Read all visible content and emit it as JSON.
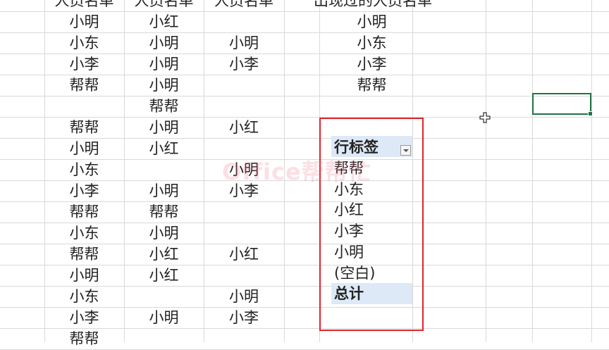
{
  "watermark": "Office帮帮忙",
  "sheet": {
    "header_cells": [
      "人员名单",
      "人员名单",
      "人员名单",
      "出现过的人员名单"
    ],
    "col_a": [
      "小明",
      "小东",
      "小李",
      "帮帮",
      "",
      "帮帮",
      "小明",
      "小东",
      "小李",
      "帮帮",
      "小东",
      "帮帮",
      "小明",
      "小东",
      "小李",
      "帮帮"
    ],
    "col_b": [
      "小红",
      "小明",
      "小明",
      "小明",
      "帮帮",
      "小明",
      "小红",
      "",
      "小明",
      "帮帮",
      "小明",
      "小红",
      "小红",
      "",
      "小明",
      ""
    ],
    "col_c": [
      "",
      "小明",
      "小李",
      "",
      "",
      "小红",
      "",
      "小明",
      "小李",
      "",
      "",
      "小红",
      "",
      "小明",
      "小李",
      ""
    ],
    "col_e": [
      "小明",
      "小东",
      "小李",
      "帮帮"
    ]
  },
  "pivot": {
    "header": "行标签",
    "rows": [
      "帮帮",
      "小东",
      "小红",
      "小李",
      "小明",
      "(空白)"
    ],
    "total": "总计"
  },
  "colors": {
    "grid": "#d9d9d9",
    "pivot_fill": "#dde9f6",
    "highlight_box": "#e2232c",
    "selection": "#217346"
  },
  "icons": {
    "filter": "dropdown-filter-icon",
    "cursor": "crosshair-cursor-icon"
  }
}
